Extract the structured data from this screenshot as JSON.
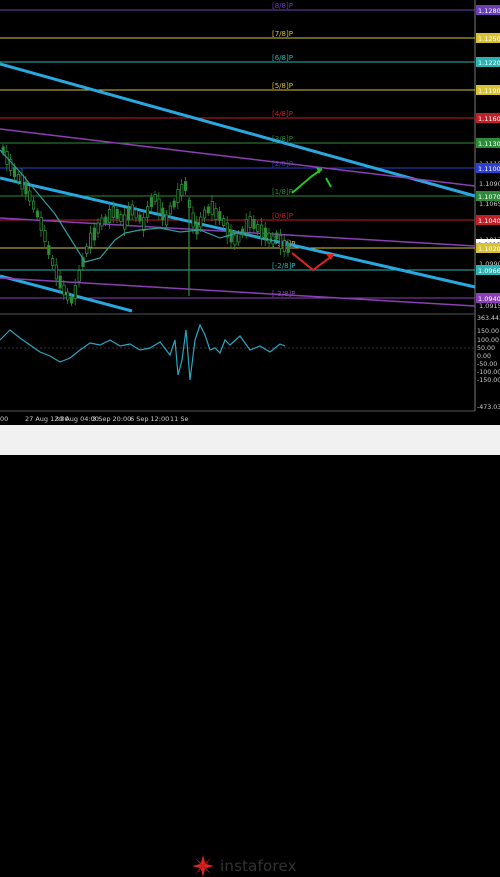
{
  "colors": {
    "background": "#000000",
    "candle_up": "#2e8b3a",
    "candle_down": "#2e8b3a",
    "ma_line": "#2e9e9e",
    "channel": "#29a8e0",
    "purple_line": "#8a3fb5",
    "red_level": "#c0202a",
    "yellow_level": "#d7c234",
    "white_grid": "#d8d8d8",
    "arrow_up": "#27c327",
    "arrow_down": "#e02424",
    "osc_line": "#2ba6c4",
    "price_box": "#2c6fd1",
    "footer_bg": "#f1f1f1"
  },
  "murray_levels": [
    {
      "label": "[8/8]P",
      "price": "1.1280",
      "color": "#6a3fb5",
      "tag_bg": "#6a3fb5"
    },
    {
      "label": "[7/8]P",
      "price": "1.1250",
      "color": "#d7c234",
      "tag_bg": "#d7c234"
    },
    {
      "label": "[6/8]P",
      "price": "1.1220",
      "color": "#2bb3b3",
      "tag_bg": "#2bb3b3"
    },
    {
      "label": "[5/8]P",
      "price": "1.1190",
      "color": "#d7c234",
      "tag_bg": "#d7c234"
    },
    {
      "label": "[4/8]P",
      "price": "1.1160",
      "color": "#c0202a",
      "tag_bg": "#c0202a"
    },
    {
      "label": "[3/8]P",
      "price": "1.1130",
      "color": "#2e8b3a",
      "tag_bg": "#2e8b3a"
    },
    {
      "label": "[2/8]P",
      "price": "1.1100",
      "color": "#2c3fd1",
      "tag_bg": "#2c3fd1"
    },
    {
      "label": "[1/8]P",
      "price": "1.1070",
      "color": "#2e8b3a",
      "tag_bg": "#2e8b3a"
    },
    {
      "label": "[0/8]P",
      "price": "1.1040",
      "color": "#c0202a",
      "tag_bg": "#c0202a"
    },
    {
      "label": "[-1/8]P",
      "price": "1.1020",
      "color": "#d7c234",
      "tag_bg": "#d7c234"
    },
    {
      "label": "[-2/8]P",
      "price": "1.0966",
      "color": "#2bb3b3",
      "tag_bg": "#2bb3b3"
    },
    {
      "label": "[-3/8]P",
      "price": "1.0940",
      "color": "#8a3fb5",
      "tag_bg": "#8a3fb5"
    }
  ],
  "price_axis": [
    "1.1280",
    "1.1250",
    "1.1220",
    "1.1190",
    "1.1160",
    "1.1130",
    "1.1115",
    "1.1090",
    "1.1065",
    "1.1040",
    "1.1017",
    "1.1013",
    "1.0990",
    "1.0966",
    "1.0940",
    "1.0915"
  ],
  "current_price": "1.1013",
  "osc_axis": [
    "363.4436",
    "150.00",
    "100.00",
    "50.00",
    "0.00",
    "-50.00",
    "-100.00",
    "-150.00",
    "-473.030"
  ],
  "time_axis": [
    "00",
    "27 Aug 12:00",
    "30 Aug 04:00",
    "3 Sep 20:00",
    "6 Sep 12:00",
    "11 Se"
  ],
  "watermark": "instaforex"
}
